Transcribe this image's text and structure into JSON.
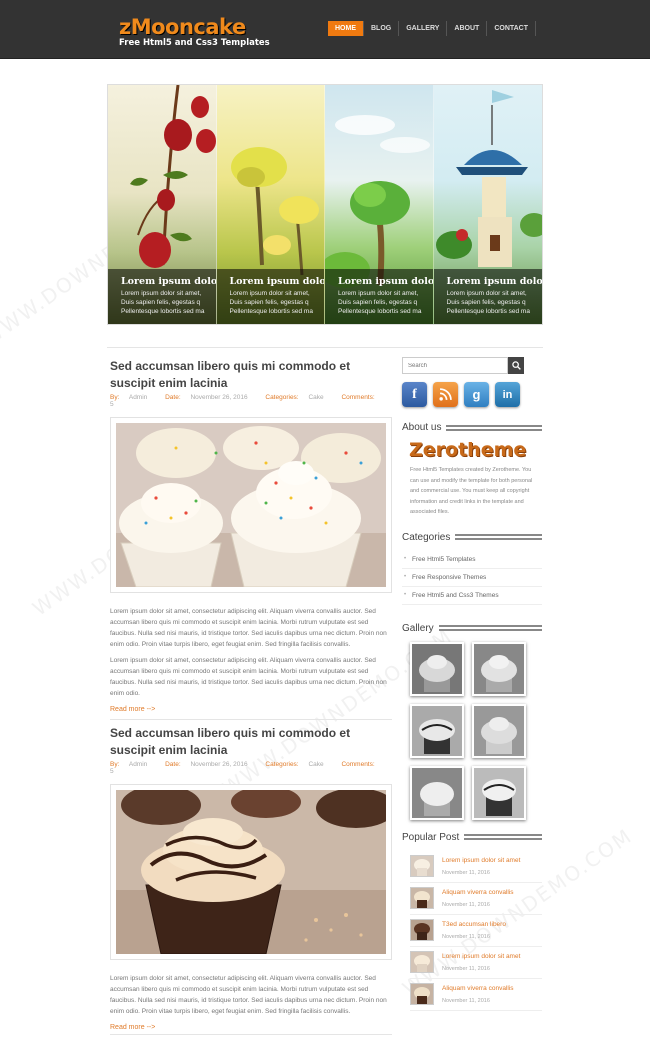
{
  "header": {
    "logo_title": "zMooncake",
    "logo_subtitle": "Free Html5 and Css3 Templates",
    "nav": [
      "HOME",
      "BLOG",
      "GALLERY",
      "ABOUT",
      "CONTACT"
    ]
  },
  "slider": {
    "panels": [
      {
        "title": "Lorem ipsum dolor s",
        "line1": "Lorem ipsum dolor sit amet,",
        "line2": "Duis sapien felis, egestas q",
        "line3": "Pellentesque lobortis sed ma"
      },
      {
        "title": "Lorem ipsum dolor s",
        "line1": "Lorem ipsum dolor sit amet,",
        "line2": "Duis sapien felis, egestas q",
        "line3": "Pellentesque lobortis sed ma"
      },
      {
        "title": "Lorem ipsum dolor s",
        "line1": "Lorem ipsum dolor sit amet,",
        "line2": "Duis sapien felis, egestas q",
        "line3": "Pellentesque lobortis sed ma"
      },
      {
        "title": "Lorem ipsum dolor s",
        "line1": "Lorem ipsum dolor sit amet,",
        "line2": "Duis sapien felis, egestas q",
        "line3": "Pellentesque lobortis sed ma"
      }
    ]
  },
  "posts": [
    {
      "title": "Sed accumsan libero quis mi commodo et suscipit enim lacinia",
      "by_label": "By:",
      "author": "Admin",
      "date_label": "Date:",
      "date": "November 26, 2016",
      "cat_label": "Categories:",
      "category": "Cake",
      "comments_label": "Comments:",
      "comments": "5",
      "para1": "Lorem ipsum dolor sit amet, consectetur adipiscing elit. Aliquam viverra convallis auctor. Sed accumsan libero quis mi commodo et suscipit enim lacinia. Morbi rutrum vulputate est sed faucibus. Nulla sed nisi mauris, id tristique tortor. Sed iaculis dapibus urna nec dictum. Proin non enim odio. Proin vitae turpis libero, eget feugiat enim. Sed fringilla facilisis convallis.",
      "para2": "Lorem ipsum dolor sit amet, consectetur adipiscing elit. Aliquam viverra convallis auctor. Sed accumsan libero quis mi commodo et suscipit enim lacinia. Morbi rutrum vulputate est sed faucibus. Nulla sed nisi mauris, id tristique tortor. Sed iaculis dapibus urna nec dictum. Proin non enim odio.",
      "readmore": "Read more -->"
    },
    {
      "title": "Sed accumsan libero quis mi commodo et suscipit enim lacinia",
      "by_label": "By:",
      "author": "Admin",
      "date_label": "Date:",
      "date": "November 26, 2016",
      "cat_label": "Categories:",
      "category": "Cake",
      "comments_label": "Comments:",
      "comments": "5",
      "para1": "Lorem ipsum dolor sit amet, consectetur adipiscing elit. Aliquam viverra convallis auctor. Sed accumsan libero quis mi commodo et suscipit enim lacinia. Morbi rutrum vulputate est sed faucibus. Nulla sed nisi mauris, id tristique tortor. Sed iaculis dapibus urna nec dictum. Proin non enim odio. Proin vitae turpis libero, eget feugiat enim. Sed fringilla facilisis convallis.",
      "readmore": "Read more -->"
    }
  ],
  "sidebar": {
    "search_placeholder": "Search",
    "social": [
      "f",
      "rss",
      "g",
      "in"
    ],
    "about_title": "About us",
    "about_logo": "Zerotheme",
    "about_text": "Free Html5 Templates created by Zerotheme. You can use and modify the template for both personal and commercial use. You must keep all copyright information and credit links in the template and associated files.",
    "categories_title": "Categories",
    "categories": [
      "Free Html5 Templates",
      "Free Responsive Themes",
      "Free Html5 and Css3 Themes"
    ],
    "gallery_title": "Gallery",
    "popular_title": "Popular Post",
    "popular": [
      {
        "title": "Lorem ipsum dolor sit amet",
        "date": "November 11, 2016"
      },
      {
        "title": "Aliquam viverra convallis",
        "date": "November 11, 2016"
      },
      {
        "title": "T3ed accumsan libero",
        "date": "November 11, 2016"
      },
      {
        "title": "Lorem ipsum dolor sit amet",
        "date": "November 11, 2016"
      },
      {
        "title": "Aliquam viverra convallis",
        "date": "November 11, 2016"
      }
    ]
  },
  "watermark": "WWW.DOWNDEMO.COM",
  "colors": {
    "accent": "#f07a10",
    "header_bg": "#333333",
    "link": "#e07b2a"
  }
}
